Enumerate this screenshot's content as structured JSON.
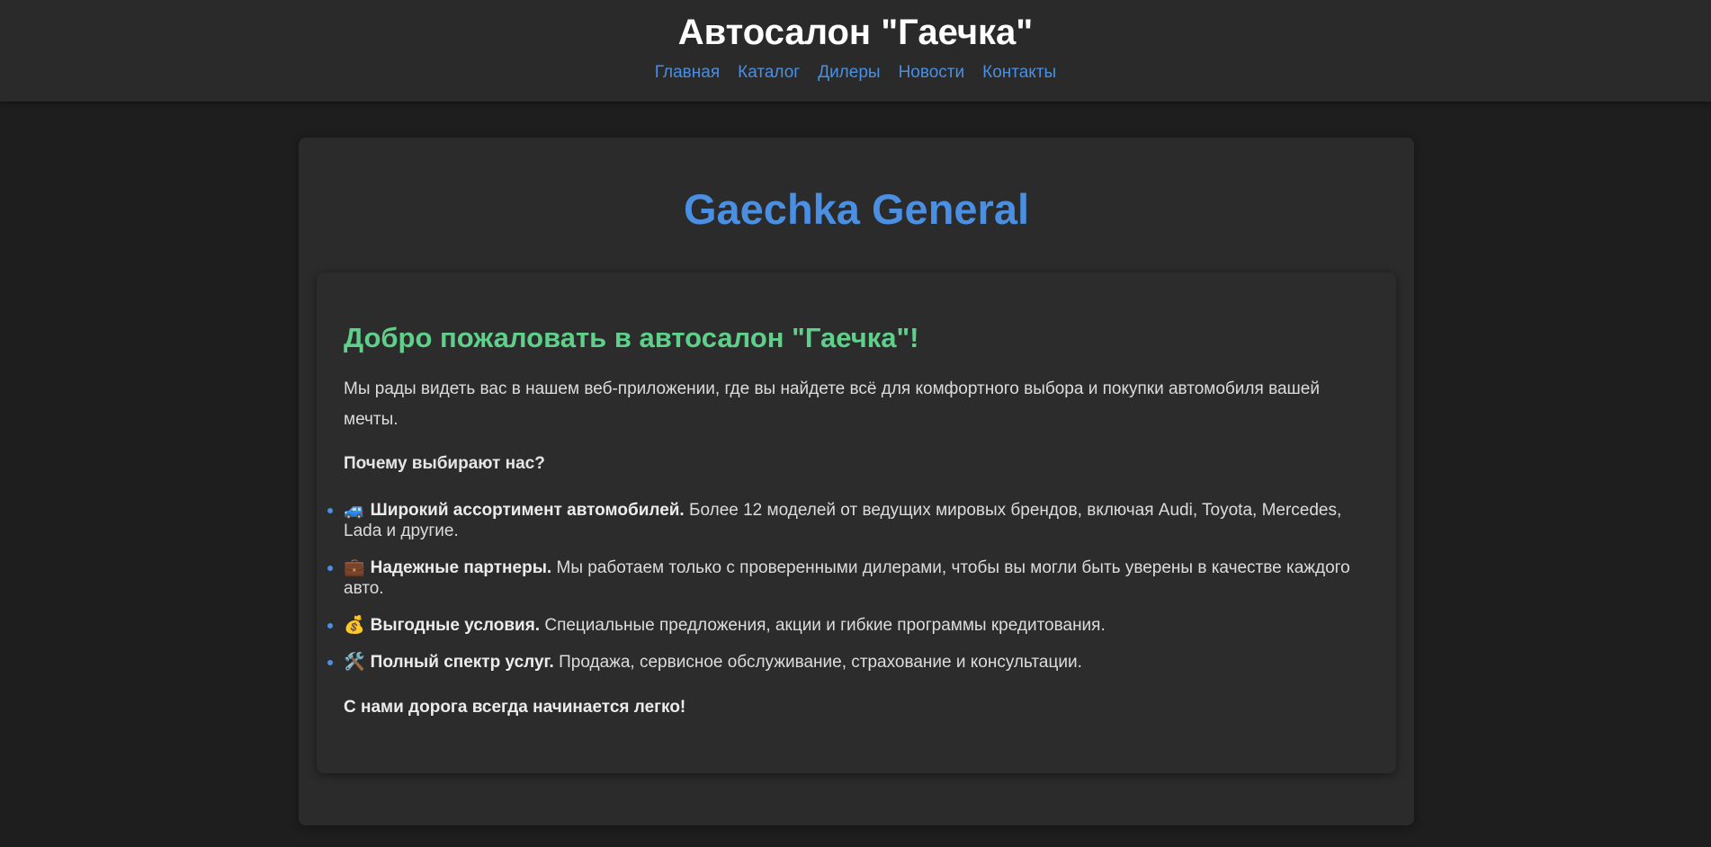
{
  "header": {
    "title": "Автосалон \"Гаечка\"",
    "nav": [
      {
        "label": "Главная"
      },
      {
        "label": "Каталог"
      },
      {
        "label": "Дилеры"
      },
      {
        "label": "Новости"
      },
      {
        "label": "Контакты"
      }
    ]
  },
  "main": {
    "brand": "Gaechka General",
    "welcome": {
      "title": "Добро пожаловать в автосалон \"Гаечка\"!",
      "intro": "Мы рады видеть вас в нашем веб-приложении, где вы найдете всё для комфортного выбора и покупки автомобиля вашей мечты.",
      "why_heading": "Почему выбирают нас?",
      "features": [
        {
          "icon": "🚙",
          "title": "Широкий ассортимент автомобилей.",
          "text": " Более 12 моделей от ведущих мировых брендов, включая Audi, Toyota, Mercedes, Lada и другие."
        },
        {
          "icon": "💼",
          "title": "Надежные партнеры.",
          "text": " Мы работаем только с проверенными дилерами, чтобы вы могли быть уверены в качестве каждого авто."
        },
        {
          "icon": "💰",
          "title": "Выгодные условия.",
          "text": " Специальные предложения, акции и гибкие программы кредитования."
        },
        {
          "icon": "🛠️",
          "title": "Полный спектр услуг.",
          "text": " Продажа, сервисное обслуживание, страхование и консультации."
        }
      ],
      "closing": "С нами дорога всегда начинается легко!"
    }
  },
  "colors": {
    "accent": "#4a8fe2",
    "welcome_title": "#5fd08a",
    "background": "#1e1e1e",
    "header_bg": "#2a2a2a",
    "card_bg": "#2b2b2b"
  }
}
